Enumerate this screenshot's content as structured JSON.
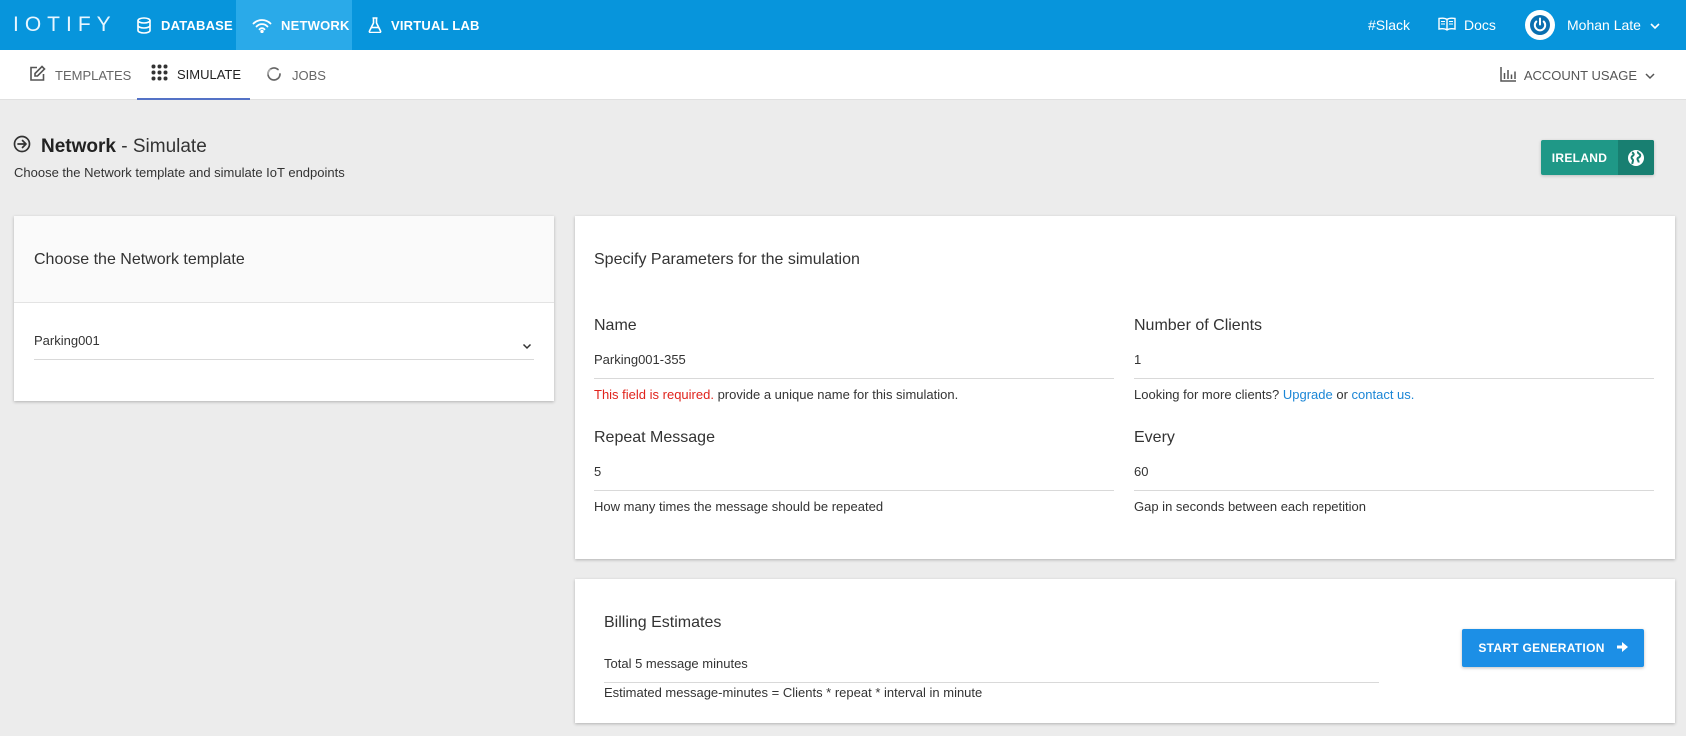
{
  "app": {
    "logo_text": "IOTIFY"
  },
  "topnav": {
    "database": "DATABASE",
    "network": "NETWORK",
    "virtual_lab": "VIRTUAL LAB",
    "slack": "#Slack",
    "docs": "Docs",
    "user_name": "Mohan Late"
  },
  "subnav": {
    "templates": "TEMPLATES",
    "simulate": "SIMULATE",
    "jobs": "JOBS",
    "account_usage": "ACCOUNT USAGE"
  },
  "page": {
    "title_bold": "Network",
    "title_rest": " - Simulate",
    "subtitle": "Choose the Network template and simulate IoT endpoints",
    "region_label": "IRELAND"
  },
  "template_card": {
    "title": "Choose the Network template",
    "selected": "Parking001"
  },
  "params": {
    "title": "Specify Parameters for the simulation",
    "name": {
      "label": "Name",
      "value": "Parking001-355",
      "error": "This field is required.",
      "help": " provide a unique name for this simulation."
    },
    "clients": {
      "label": "Number of Clients",
      "value": "1",
      "help_prefix": "Looking for more clients? ",
      "upgrade_link": "Upgrade",
      "or": " or ",
      "contact_link": "contact us."
    },
    "repeat": {
      "label": "Repeat Message",
      "value": "5",
      "help": "How many times the message should be repeated"
    },
    "every": {
      "label": "Every",
      "value": "60",
      "help": "Gap in seconds between each repetition"
    }
  },
  "billing": {
    "title": "Billing Estimates",
    "total": "Total 5 message minutes",
    "formula": "Estimated message-minutes = Clients * repeat * interval in minute",
    "start_button": "START GENERATION"
  },
  "colors": {
    "topbar": "#0795dc",
    "topnav_active": "#2aaae9",
    "region_button": "#1f9887",
    "primary_button": "#1c8fe6",
    "error": "#e0231c",
    "link": "#1b86d6"
  }
}
